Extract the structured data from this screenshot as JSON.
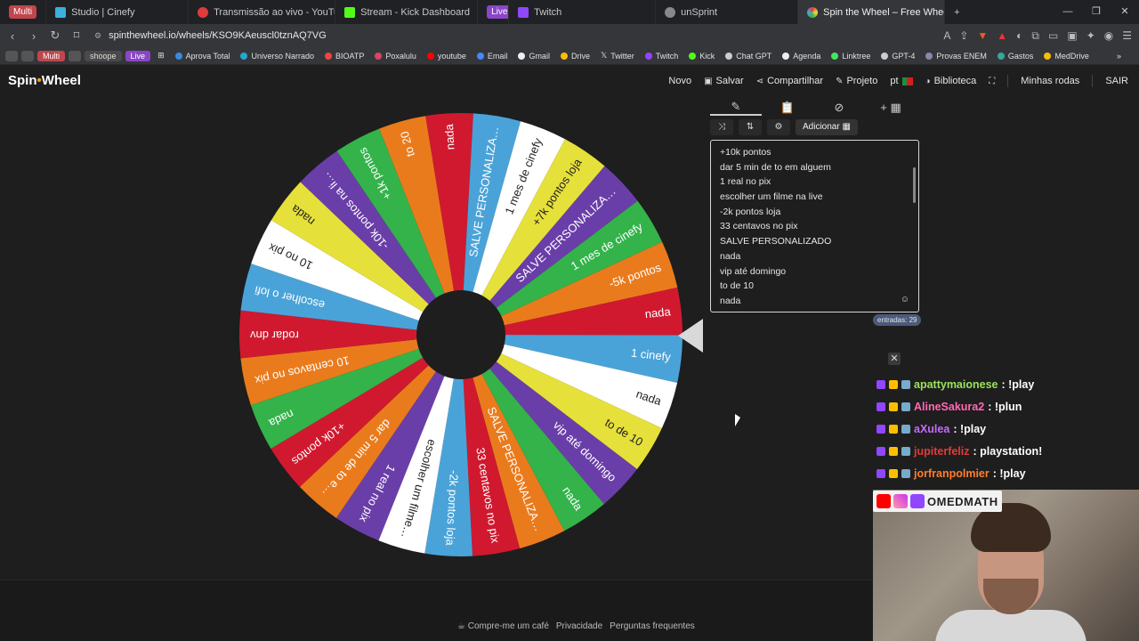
{
  "browser": {
    "multi_badge": "Multi",
    "tabs": [
      {
        "label": "Studio | Cinefy",
        "color": "#3ab0e0"
      },
      {
        "label": "Transmissão ao vivo - YouTube Studio",
        "color": "#e03a3a"
      },
      {
        "label": "Stream - Kick Dashboard",
        "color": "#53fc18"
      },
      {
        "label": "Live",
        "color": "#8a46c8"
      },
      {
        "label": "Twitch",
        "color": "#9146ff"
      },
      {
        "label": "unSprint",
        "color": "#888888"
      },
      {
        "label": "Spin the Wheel – Free Wheel Sp",
        "color": "#e03a8a"
      }
    ],
    "url": "spinthewheel.io/wheels/KSO9KAeuscl0tznAQ7VG",
    "bookmarks": [
      "Multi",
      "shoope",
      "Live",
      "Aprova Total",
      "Universo Narrado",
      "BIOATP",
      "Poxalulu",
      "youtube",
      "Email",
      "Gmail",
      "Drive",
      "Twitter",
      "Twitch",
      "Kick",
      "Chat GPT",
      "Agenda",
      "Linktree",
      "GPT-4",
      "Provas ENEM",
      "Gastos",
      "MedDrive"
    ]
  },
  "app": {
    "logo_left": "Spin",
    "logo_dot": "•",
    "logo_right": "Wheel",
    "nav": {
      "novo": "Novo",
      "salvar": "Salvar",
      "compartilhar": "Compartilhar",
      "projeto": "Projeto",
      "lang": "pt",
      "biblioteca": "Biblioteca",
      "minhas_rodas": "Minhas rodas",
      "sair": "SAIR"
    },
    "add_button": "Adicionar",
    "entries_count": "entradas: 29",
    "entries": [
      "+10k pontos",
      "dar 5 min de to em alguem",
      "1 real no pix",
      "escolher um filme na live",
      "-2k pontos loja",
      "33 centavos no pix",
      "SALVE PERSONALIZADO",
      "nada",
      "vip até domingo",
      "to de 10",
      "nada"
    ]
  },
  "wheel": {
    "segments": [
      {
        "label": "nada",
        "color": "#d0192f"
      },
      {
        "label": "SALVE PERSONALIZA…",
        "color": "#4aa3d8"
      },
      {
        "label": "1 mes de cinefy",
        "color": "#ffffff"
      },
      {
        "label": "+7k pontos loja",
        "color": "#e6e03a"
      },
      {
        "label": "SALVE PERSONALIZA…",
        "color": "#6a3ea8"
      },
      {
        "label": "1 mes de cinefy",
        "color": "#33b34a"
      },
      {
        "label": "-5k pontos",
        "color": "#ea7b1c"
      },
      {
        "label": "nada",
        "color": "#d0192f"
      },
      {
        "label": "1 cinefy",
        "color": "#4aa3d8"
      },
      {
        "label": "nada",
        "color": "#ffffff"
      },
      {
        "label": "to de 10",
        "color": "#e6e03a"
      },
      {
        "label": "vip até domingo",
        "color": "#6a3ea8"
      },
      {
        "label": "nada",
        "color": "#33b34a"
      },
      {
        "label": "SALVE PERSONALIZA…",
        "color": "#ea7b1c"
      },
      {
        "label": "33 centavos no pix",
        "color": "#d0192f"
      },
      {
        "label": "-2k pontos loja",
        "color": "#4aa3d8"
      },
      {
        "label": "escolher um filme…",
        "color": "#ffffff"
      },
      {
        "label": "1 real no pix",
        "color": "#6a3ea8"
      },
      {
        "label": "dar 5 min de to e…",
        "color": "#ea7b1c"
      },
      {
        "label": "+10k pontos",
        "color": "#d0192f"
      },
      {
        "label": "nada",
        "color": "#33b34a"
      },
      {
        "label": "10 centavos no pix",
        "color": "#ea7b1c"
      },
      {
        "label": "rodar dnv",
        "color": "#d0192f"
      },
      {
        "label": "escolher o lofi",
        "color": "#4aa3d8"
      },
      {
        "label": "10 no pix",
        "color": "#ffffff"
      },
      {
        "label": "nada",
        "color": "#e6e03a"
      },
      {
        "label": "-10k pontos na li…",
        "color": "#6a3ea8"
      },
      {
        "label": "+1k pontos",
        "color": "#33b34a"
      },
      {
        "label": "to 20",
        "color": "#ea7b1c"
      }
    ]
  },
  "chat": [
    {
      "user": "apattymaionese",
      "text": ": !play",
      "color": "#9ae35a"
    },
    {
      "user": "AlineSakura2",
      "text": ": !plun",
      "color": "#ff69b4"
    },
    {
      "user": "aXulea",
      "text": ": !play",
      "color": "#c36bff"
    },
    {
      "user": "jupiterfeliz",
      "text": ": playstation!",
      "color": "#e23b3b"
    },
    {
      "user": "jorfranpolmier",
      "text": ": !play",
      "color": "#ff7f2a"
    }
  ],
  "cam_name": "OMEDMATH",
  "footer": {
    "coffee": "Compre-me um café",
    "privacy": "Privacidade",
    "faq": "Perguntas frequentes"
  }
}
